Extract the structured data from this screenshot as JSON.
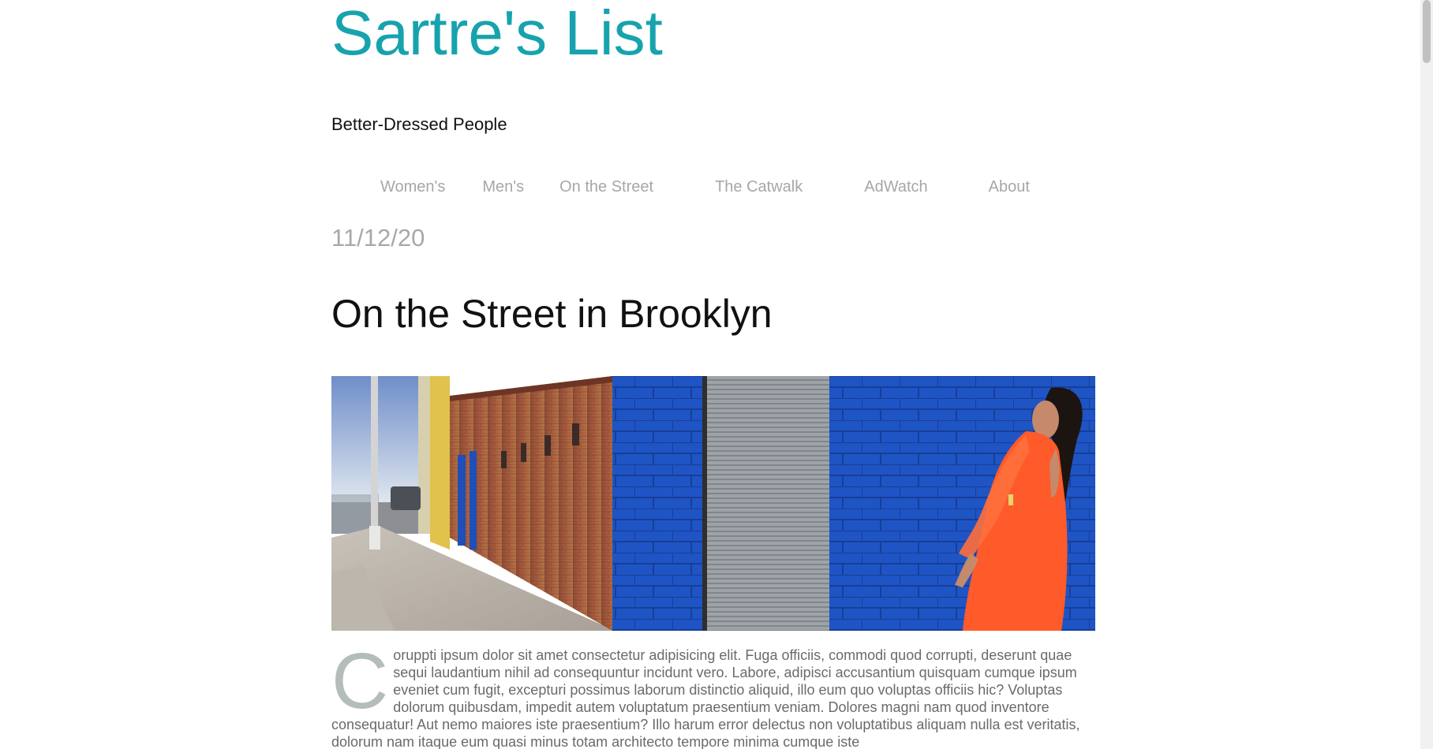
{
  "site": {
    "title": "Sartre's List",
    "tagline": "Better-Dressed People"
  },
  "nav": {
    "items": [
      {
        "label": "Women's"
      },
      {
        "label": "Men's"
      },
      {
        "label": "On the Street"
      },
      {
        "label": "The Catwalk"
      },
      {
        "label": "AdWatch"
      },
      {
        "label": "About"
      }
    ]
  },
  "post": {
    "date": "11/12/20",
    "title": "On the Street in Brooklyn",
    "dropcap": "C",
    "body": "oruppti ipsum dolor sit amet consectetur adipisicing elit. Fuga officiis, commodi quod corrupti, deserunt quae sequi laudantium nihil ad consequuntur incidunt vero. Labore, adipisci accusantium quisquam cumque ipsum eveniet cum fugit, excepturi possimus laborum distinctio aliquid, illo eum quo voluptas officiis hic? Voluptas dolorum quibusdam, impedit autem voluptatum praesentium veniam. Dolores magni nam quod inventore consequatur! Aut nemo maiores iste praesentium? Illo harum error delectus non voluptatibus aliquam nulla est veritatis, dolorum nam itaque eum quasi minus totam architecto tempore minima cumque iste"
  },
  "colors": {
    "title_accent": "#17a3ad",
    "nav_text": "#a7a7a7",
    "date_text": "#a8a8a8",
    "body_text": "#6a6a6a"
  }
}
